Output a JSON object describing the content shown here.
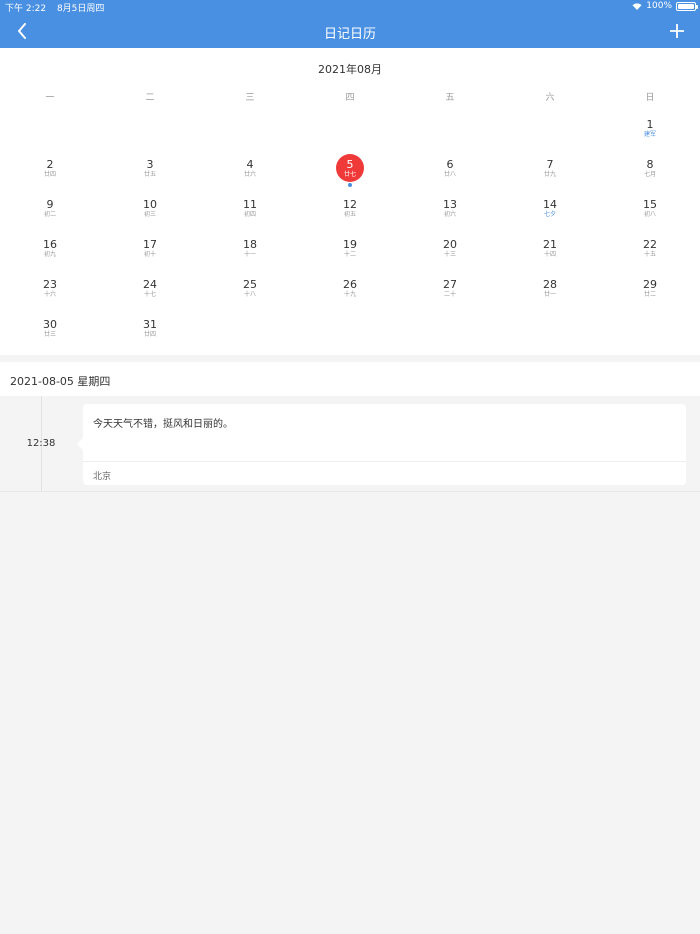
{
  "status": {
    "time": "下午 2:22",
    "date": "8月5日周四",
    "battery": "100%",
    "battery_level": 1.0
  },
  "nav": {
    "title": "日记日历"
  },
  "calendar": {
    "month_title": "2021年08月",
    "weekdays": [
      "一",
      "二",
      "三",
      "四",
      "五",
      "六",
      "日"
    ],
    "weeks": [
      [
        null,
        null,
        null,
        null,
        null,
        null,
        {
          "day": "1",
          "lunar": "建军",
          "festival": true
        }
      ],
      [
        {
          "day": "2",
          "lunar": "廿四"
        },
        {
          "day": "3",
          "lunar": "廿五"
        },
        {
          "day": "4",
          "lunar": "廿六"
        },
        {
          "day": "5",
          "lunar": "廿七",
          "selected": true,
          "has_entry": true
        },
        {
          "day": "6",
          "lunar": "廿八"
        },
        {
          "day": "7",
          "lunar": "廿九"
        },
        {
          "day": "8",
          "lunar": "七月"
        }
      ],
      [
        {
          "day": "9",
          "lunar": "初二"
        },
        {
          "day": "10",
          "lunar": "初三"
        },
        {
          "day": "11",
          "lunar": "初四"
        },
        {
          "day": "12",
          "lunar": "初五"
        },
        {
          "day": "13",
          "lunar": "初六"
        },
        {
          "day": "14",
          "lunar": "七夕",
          "festival": true
        },
        {
          "day": "15",
          "lunar": "初八"
        }
      ],
      [
        {
          "day": "16",
          "lunar": "初九"
        },
        {
          "day": "17",
          "lunar": "初十"
        },
        {
          "day": "18",
          "lunar": "十一"
        },
        {
          "day": "19",
          "lunar": "十二"
        },
        {
          "day": "20",
          "lunar": "十三"
        },
        {
          "day": "21",
          "lunar": "十四"
        },
        {
          "day": "22",
          "lunar": "十五"
        }
      ],
      [
        {
          "day": "23",
          "lunar": "十六"
        },
        {
          "day": "24",
          "lunar": "十七"
        },
        {
          "day": "25",
          "lunar": "十八"
        },
        {
          "day": "26",
          "lunar": "十九"
        },
        {
          "day": "27",
          "lunar": "二十"
        },
        {
          "day": "28",
          "lunar": "廿一"
        },
        {
          "day": "29",
          "lunar": "廿二"
        }
      ],
      [
        {
          "day": "30",
          "lunar": "廿三"
        },
        {
          "day": "31",
          "lunar": "廿四"
        },
        null,
        null,
        null,
        null,
        null
      ]
    ]
  },
  "selected_date": {
    "label": "2021-08-05 星期四"
  },
  "entries": [
    {
      "time": "12:38",
      "text": "今天天气不错，挺风和日丽的。",
      "location": "北京"
    }
  ],
  "colors": {
    "primary": "#4a90e2",
    "selected": "#f03a3a",
    "background": "#f4f4f4"
  }
}
